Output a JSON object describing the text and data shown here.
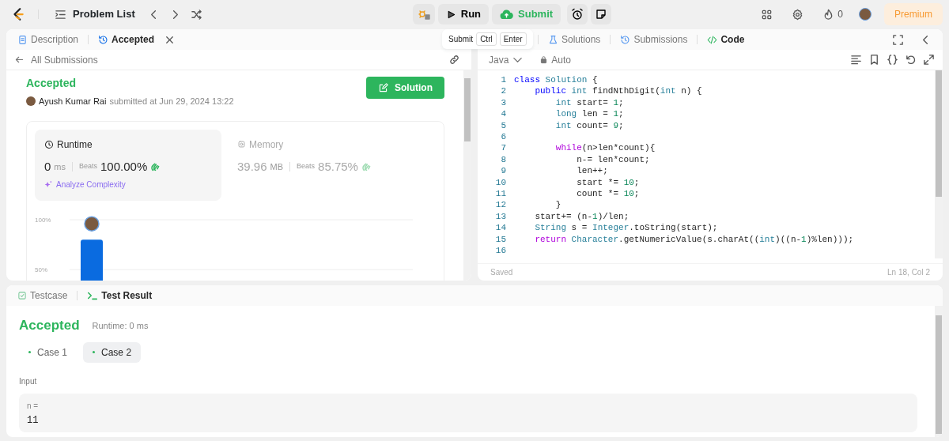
{
  "topbar": {
    "problem_list": "Problem List",
    "run": "Run",
    "submit": "Submit",
    "streak": "0",
    "premium": "Premium"
  },
  "tooltip": {
    "label": "Submit",
    "keys": [
      "Ctrl",
      "Enter"
    ]
  },
  "left_tabs": [
    {
      "label": "Description",
      "selected": false,
      "closable": false
    },
    {
      "label": "Accepted",
      "selected": true,
      "closable": true
    }
  ],
  "submission": {
    "back_link": "All Submissions",
    "status": "Accepted",
    "user": "Ayush Kumar Rai",
    "submitted": "submitted at Jun 29, 2024 13:22",
    "solution_button": "Solution"
  },
  "metrics": [
    {
      "kind": "runtime",
      "title": "Runtime",
      "value": "0",
      "unit": "ms",
      "beats_label": "Beats",
      "beats": "100.00%",
      "analyze": "Analyze Complexity",
      "selected": true
    },
    {
      "kind": "memory",
      "title": "Memory",
      "value": "39.96",
      "unit": "MB",
      "beats_label": "Beats",
      "beats": "85.75%",
      "selected": false
    }
  ],
  "chart_data": {
    "type": "bar",
    "values": [
      80
    ],
    "ylim": [
      0,
      100
    ],
    "yticks": [
      {
        "value": 100,
        "label": "100%"
      },
      {
        "value": 50,
        "label": "50%"
      }
    ]
  },
  "right_tabs": [
    {
      "label": "Solutions",
      "selected": false
    },
    {
      "label": "Submissions",
      "selected": false
    },
    {
      "label": "Code",
      "selected": true
    }
  ],
  "editor": {
    "language": "Java",
    "mode": "Auto",
    "status": "Saved",
    "cursor": "Ln 18, Col 2",
    "lines": [
      {
        "number": "1",
        "tokens": [
          {
            "text": "class",
            "kind": "kw"
          },
          {
            "text": " Solution",
            "kind": "type"
          },
          {
            "text": " {"
          }
        ]
      },
      {
        "number": "2",
        "tokens": [
          {
            "text": "    public",
            "kind": "kw"
          },
          {
            "text": " int",
            "kind": "type"
          },
          {
            "text": " findNthDigit("
          },
          {
            "text": "int",
            "kind": "type"
          },
          {
            "text": " n) {"
          }
        ]
      },
      {
        "number": "3",
        "tokens": [
          {
            "text": "        int",
            "kind": "type"
          },
          {
            "text": " start= "
          },
          {
            "text": "1",
            "kind": "num"
          },
          {
            "text": ";"
          }
        ]
      },
      {
        "number": "4",
        "tokens": [
          {
            "text": "        long",
            "kind": "type"
          },
          {
            "text": " len = "
          },
          {
            "text": "1",
            "kind": "num"
          },
          {
            "text": ";"
          }
        ]
      },
      {
        "number": "5",
        "tokens": [
          {
            "text": "        int",
            "kind": "type"
          },
          {
            "text": " count= "
          },
          {
            "text": "9",
            "kind": "num"
          },
          {
            "text": ";"
          }
        ]
      },
      {
        "number": "6"
      },
      {
        "number": "7",
        "tokens": [
          {
            "text": "        while",
            "kind": "ctrl"
          },
          {
            "text": "(n>len*count){"
          }
        ]
      },
      {
        "number": "8",
        "tokens": [
          {
            "text": "            n-= len*count;"
          }
        ]
      },
      {
        "number": "9",
        "tokens": [
          {
            "text": "            len++;"
          }
        ]
      },
      {
        "number": "10",
        "tokens": [
          {
            "text": "            start *= "
          },
          {
            "text": "10",
            "kind": "num"
          },
          {
            "text": ";"
          }
        ]
      },
      {
        "number": "11",
        "tokens": [
          {
            "text": "            count *= "
          },
          {
            "text": "10",
            "kind": "num"
          },
          {
            "text": ";"
          }
        ]
      },
      {
        "number": "12",
        "tokens": [
          {
            "text": "        }"
          }
        ]
      },
      {
        "number": "13",
        "tokens": [
          {
            "text": "    start+= (n-"
          },
          {
            "text": "1",
            "kind": "num"
          },
          {
            "text": ")/len;"
          }
        ]
      },
      {
        "number": "14",
        "tokens": [
          {
            "text": "    String",
            "kind": "type"
          },
          {
            "text": " s = "
          },
          {
            "text": "Integer",
            "kind": "type"
          },
          {
            "text": ".toString(start);"
          }
        ]
      },
      {
        "number": "15",
        "tokens": [
          {
            "text": "    return",
            "kind": "ctrl"
          },
          {
            "text": " Character",
            "kind": "type"
          },
          {
            "text": ".getNumericValue(s.charAt(("
          },
          {
            "text": "int",
            "kind": "type"
          },
          {
            "text": ")((n-"
          },
          {
            "text": "1",
            "kind": "num"
          },
          {
            "text": ")%len)));"
          }
        ]
      },
      {
        "number": "16"
      }
    ]
  },
  "bottom_tabs": [
    {
      "label": "Testcase",
      "selected": false
    },
    {
      "label": "Test Result",
      "selected": true
    }
  ],
  "result": {
    "status": "Accepted",
    "runtime": "Runtime: 0 ms",
    "cases": [
      {
        "label": "Case 1",
        "selected": false
      },
      {
        "label": "Case 2",
        "selected": true
      }
    ],
    "input_label": "Input",
    "inputs": [
      {
        "name": "n =",
        "value": "11"
      }
    ]
  }
}
